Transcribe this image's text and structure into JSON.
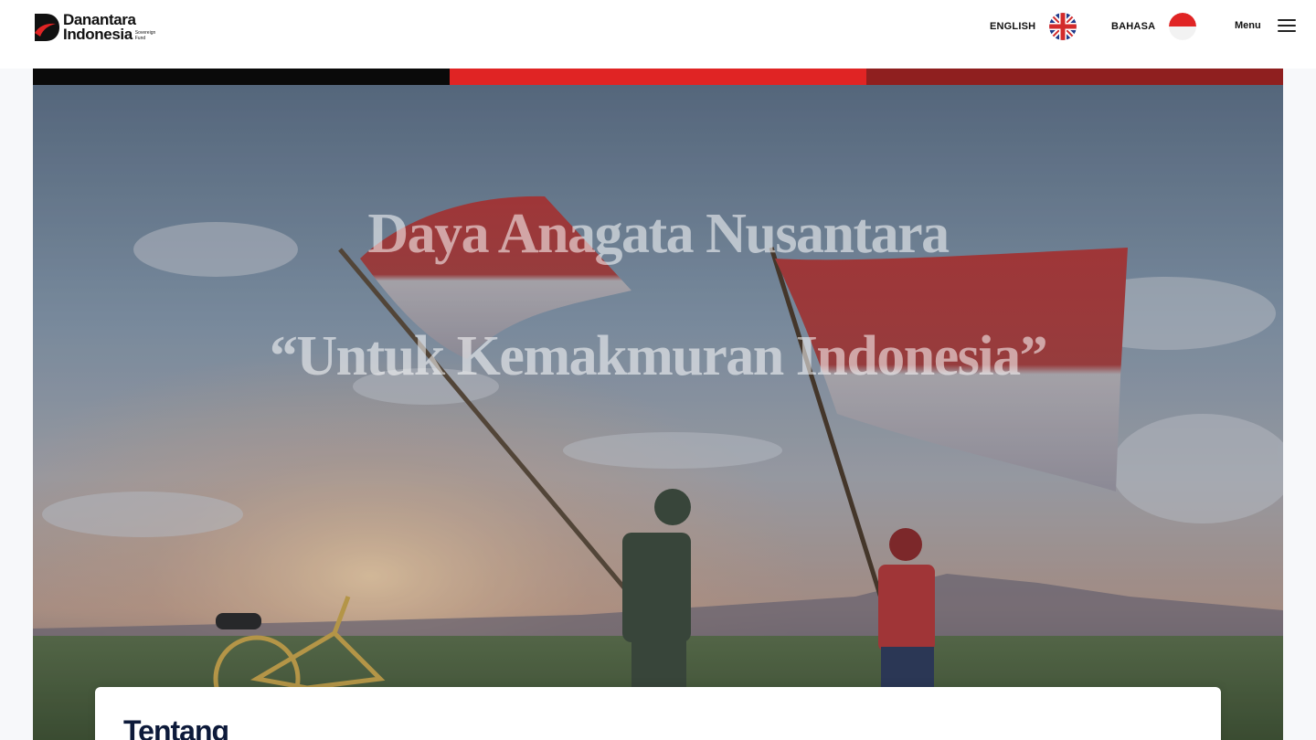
{
  "header": {
    "logo": {
      "line1": "Danantara",
      "line2": "Indonesia",
      "small_line1": "Sovereign",
      "small_line2": "Fund",
      "mark_icon": "danantara-logo-mark"
    },
    "languages": [
      {
        "label": "ENGLISH",
        "flag_icon": "uk-flag-icon"
      },
      {
        "label": "BAHASA",
        "flag_icon": "indonesia-flag-icon"
      }
    ],
    "menu_label": "Menu",
    "menu_icon": "hamburger-icon"
  },
  "strip_colors": [
    "#0a0a0a",
    "#e02424",
    "#8f1f1f"
  ],
  "hero": {
    "title": "Daya Anagata Nusantara",
    "subtitle": "“Untuk Kemakmuran Indonesia”"
  },
  "card": {
    "heading": "Tentang"
  }
}
